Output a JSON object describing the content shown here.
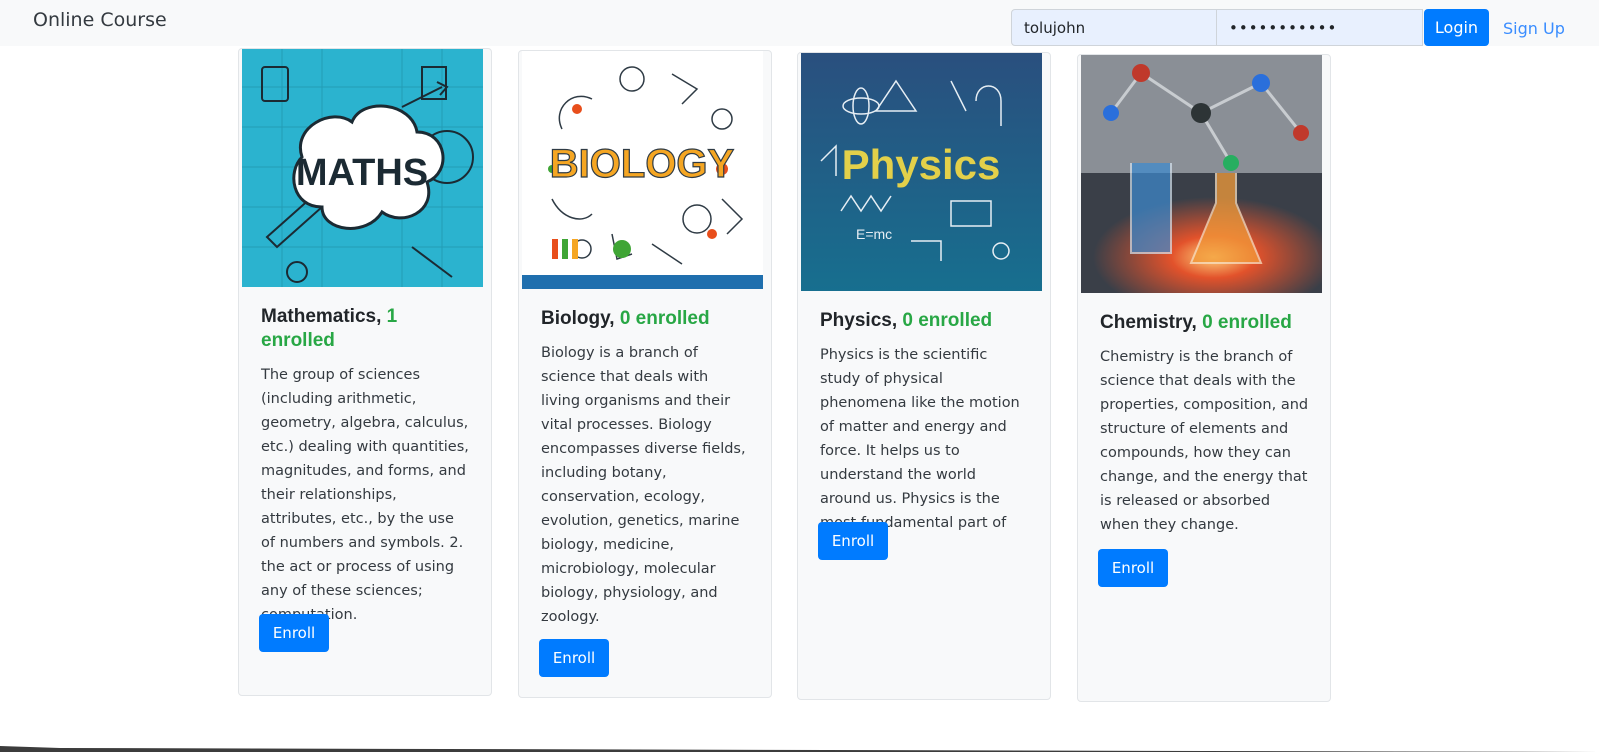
{
  "brand": "Online Course",
  "login": {
    "username_value": "tolujohn",
    "password_value": "•••••••••••",
    "login_label": "Login",
    "signup_label": "Sign Up"
  },
  "courses": [
    {
      "name": "Mathematics,",
      "enrolled": "1 enrolled",
      "description": "The group of sciences (including arithmetic, geometry, algebra, calculus, etc.) dealing with quantities, magnitudes, and forms, and their relationships, attributes, etc., by the use of numbers and symbols. 2. the act or process of using any of these sciences; computation.",
      "enroll_label": "Enroll",
      "image_text": "MATHS"
    },
    {
      "name": "Biology,",
      "enrolled": "0 enrolled",
      "description": "Biology is a branch of science that deals with living organisms and their vital processes. Biology encompasses diverse fields, including botany, conservation, ecology, evolution, genetics, marine biology, medicine, microbiology, molecular biology, physiology, and zoology.",
      "enroll_label": "Enroll",
      "image_text": "BIOLOGY"
    },
    {
      "name": "Physics,",
      "enrolled": "0 enrolled",
      "description": "Physics is the scientific study of physical phenomena like the motion of matter and energy and force. It helps us to understand the world around us. Physics is the most fundamental part of science",
      "enroll_label": "Enroll",
      "image_text": "Physics"
    },
    {
      "name": "Chemistry,",
      "enrolled": "0 enrolled",
      "description": "Chemistry is the branch of science that deals with the properties, composition, and structure of elements and compounds, how they can change, and the energy that is released or absorbed when they change.",
      "enroll_label": "Enroll",
      "image_text": ""
    }
  ],
  "colors": {
    "primary": "#007bff",
    "success": "#28a745",
    "navbar_bg": "#f8f9fa",
    "link": "#3a8dff"
  }
}
